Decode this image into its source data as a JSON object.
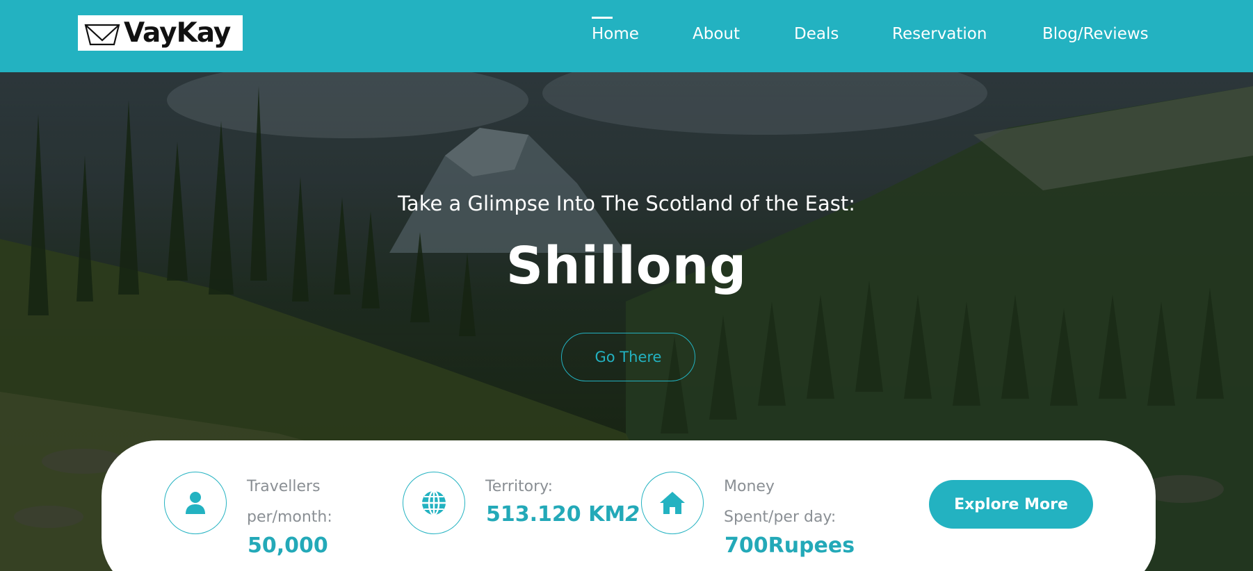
{
  "brand": {
    "name": "VayKay",
    "logo_icon": "crown-outline-icon"
  },
  "nav": {
    "items": [
      {
        "label": "Home",
        "active": true
      },
      {
        "label": "About",
        "active": false
      },
      {
        "label": "Deals",
        "active": false
      },
      {
        "label": "Reservation",
        "active": false
      },
      {
        "label": "Blog/Reviews",
        "active": false
      }
    ]
  },
  "hero": {
    "subtitle": "Take a Glimpse Into The Scotland of the East:",
    "title": "Shillong",
    "cta_label": "Go There"
  },
  "stats": [
    {
      "icon": "user-icon",
      "label_line1": "Travellers",
      "label_line2": "per/month:",
      "value": "50,000"
    },
    {
      "icon": "globe-icon",
      "label_line1": "Territory:",
      "value": "513.120 KM",
      "value_suffix": "2"
    },
    {
      "icon": "home-icon",
      "label_line1": "Money",
      "label_line2": "Spent/per day:",
      "value": "700Rupees"
    }
  ],
  "explore_label": "Explore More",
  "colors": {
    "accent": "#23b2c1",
    "header_bg": "#23b2c1",
    "muted_text": "#8a8f94",
    "card_bg": "#ffffff"
  }
}
